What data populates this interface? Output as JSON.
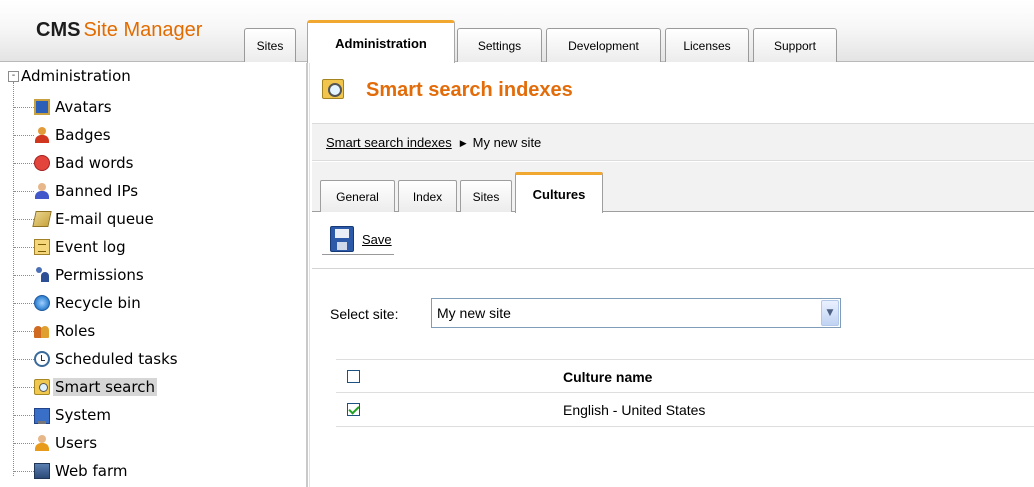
{
  "app": {
    "logo_bold": "CMS",
    "logo_rest": "Site Manager"
  },
  "top_tabs": [
    {
      "label": "Sites",
      "active": false
    },
    {
      "label": "Administration",
      "active": true
    },
    {
      "label": "Settings",
      "active": false
    },
    {
      "label": "Development",
      "active": false
    },
    {
      "label": "Licenses",
      "active": false
    },
    {
      "label": "Support",
      "active": false
    }
  ],
  "tree": {
    "root_label": "Administration",
    "toggle": "-",
    "items": [
      {
        "label": "Avatars",
        "icon": "avatars-icon"
      },
      {
        "label": "Badges",
        "icon": "badges-icon"
      },
      {
        "label": "Bad words",
        "icon": "bad-words-icon"
      },
      {
        "label": "Banned IPs",
        "icon": "banned-ips-icon"
      },
      {
        "label": "E-mail queue",
        "icon": "email-queue-icon"
      },
      {
        "label": "Event log",
        "icon": "event-log-icon"
      },
      {
        "label": "Permissions",
        "icon": "permissions-icon"
      },
      {
        "label": "Recycle bin",
        "icon": "recycle-bin-icon"
      },
      {
        "label": "Roles",
        "icon": "roles-icon"
      },
      {
        "label": "Scheduled tasks",
        "icon": "scheduled-tasks-icon"
      },
      {
        "label": "Smart search",
        "icon": "smart-search-icon",
        "selected": true
      },
      {
        "label": "System",
        "icon": "system-icon"
      },
      {
        "label": "Users",
        "icon": "users-icon"
      },
      {
        "label": "Web farm",
        "icon": "web-farm-icon"
      }
    ]
  },
  "main": {
    "title": "Smart search indexes",
    "breadcrumb": {
      "link": "Smart search indexes",
      "separator": "▶",
      "current": "My new site"
    },
    "tabs": [
      {
        "label": "General",
        "active": false
      },
      {
        "label": "Index",
        "active": false
      },
      {
        "label": "Sites",
        "active": false
      },
      {
        "label": "Cultures",
        "active": true
      }
    ],
    "toolbar": {
      "save_label": "Save"
    },
    "select_site": {
      "label": "Select site:",
      "value": "My new site"
    },
    "grid": {
      "header": "Culture name",
      "rows": [
        {
          "culture": "English - United States",
          "checked": true
        }
      ]
    }
  },
  "colors": {
    "accent_orange": "#e36c0a",
    "tab_highlight": "#f0a830",
    "check_green": "#21a121"
  }
}
